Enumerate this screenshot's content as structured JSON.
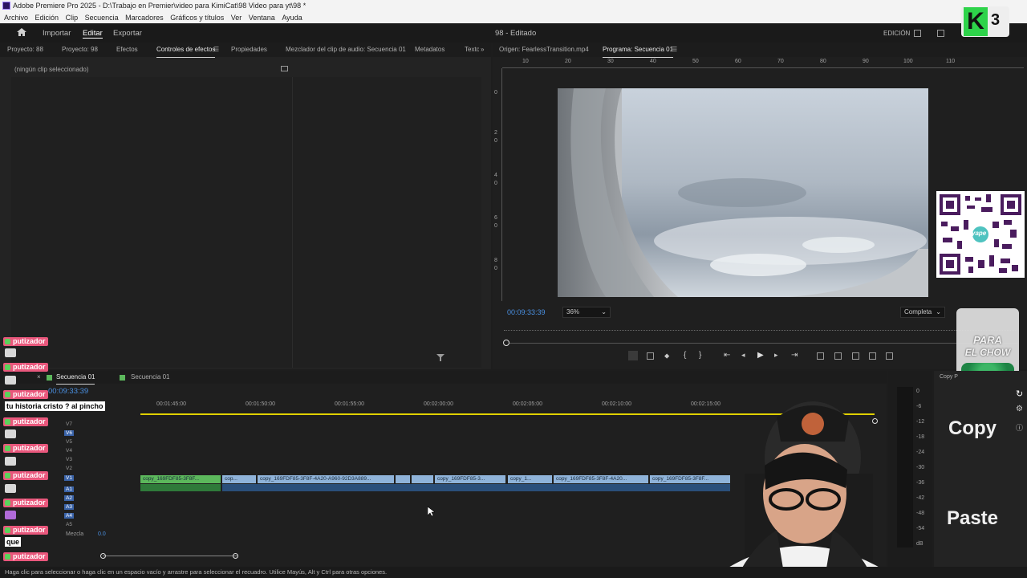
{
  "window": {
    "title": "Adobe Premiere Pro 2025 - D:\\Trabajo en Premier\\video para KimiCat\\98 Video para yt\\98 *"
  },
  "menu": [
    "Archivo",
    "Edición",
    "Clip",
    "Secuencia",
    "Marcadores",
    "Gráficos y títulos",
    "Ver",
    "Ventana",
    "Ayuda"
  ],
  "header": {
    "import": "Importar",
    "edit": "Editar",
    "export": "Exportar",
    "doc_title": "98 - Editado",
    "workspace": "EDICIÓN"
  },
  "left_tabs": [
    "Proyecto: 88",
    "Proyecto: 98",
    "Efectos",
    "Controles de efectos",
    "Propiedades",
    "Mezclador del clip de audio: Secuencia 01",
    "Metadatos",
    "Texto"
  ],
  "effect_controls": {
    "empty_label": "(ningún clip seleccionado)"
  },
  "monitor": {
    "source_tab": "Origen: FearlessTransition.mp4",
    "program_tab": "Programa: Secuencia 01",
    "ruler": [
      "10",
      "20",
      "30",
      "40",
      "50",
      "60",
      "70",
      "80",
      "90",
      "100",
      "110"
    ],
    "vruler": [
      "0",
      "2",
      "0",
      "4",
      "0",
      "6",
      "0",
      "8",
      "0"
    ],
    "timecode": "00:09:33:39",
    "zoom": "36%",
    "quality": "Completa"
  },
  "timeline": {
    "tabs": [
      "Secuencia 01",
      "Secuencia 01"
    ],
    "timecode": "00:09:33:39",
    "ruler": [
      "00:01:45:00",
      "00:01:50:00",
      "00:01:55:00",
      "00:02:00:00",
      "00:02:05:00",
      "00:02:10:00",
      "00:02:15:00"
    ],
    "video_tracks": [
      "V7",
      "V6",
      "V5",
      "V4",
      "V3",
      "V2",
      "V1"
    ],
    "audio_tracks": [
      "A1",
      "A2",
      "A3",
      "A4",
      "A5"
    ],
    "mix_label": "Mezcla",
    "mix_value": "0.0",
    "clips": [
      "copy_169FDF85-3F8F...",
      "cop...",
      "copy_169FDF85-3F8F-4A20-A960-92D3A889...",
      "copy_169FDF85-3...",
      "copy_1...",
      "copy_169FDF85-3F8F-4A20...",
      "copy_169FDF85-3F8F..."
    ]
  },
  "meter": {
    "scale": [
      "0",
      "-6",
      "-12",
      "-18",
      "-24",
      "-30",
      "-36",
      "-42",
      "-48",
      "-54",
      "dB"
    ]
  },
  "status_bar": "Haga clic para seleccionar o haga clic en un espacio vacío y arrastre para seleccionar el recuadro. Utilice Mayús, Alt y Ctrl para otras opciones.",
  "side_panel": {
    "tab": "Copy P",
    "copy": "Copy",
    "paste": "Paste"
  },
  "overlay": {
    "k3_letter": "K",
    "k3_number": "3",
    "cup_text1": "PARA",
    "cup_text2": "EL CHOW",
    "qr_label": "yape"
  },
  "chat": [
    {
      "user": "putizador",
      "msg": ""
    },
    {
      "user": "putizador",
      "msg": ""
    },
    {
      "user": "putizador",
      "msg": "tu historia cristo ? al pincho"
    },
    {
      "user": "putizador",
      "msg": ""
    },
    {
      "user": "putizador",
      "msg": ""
    },
    {
      "user": "putizador",
      "msg": ""
    },
    {
      "user": "putizador",
      "msg": ""
    },
    {
      "user": "putizador",
      "msg": "que"
    },
    {
      "user": "putizador",
      "msg": ""
    }
  ],
  "colors": {
    "accent_blue": "#4a90e2",
    "clip_green": "#5cb85c",
    "clip_blue": "#8fb3d9",
    "chat_pink": "#e9577c",
    "timeline_yellow": "#e0d000"
  }
}
